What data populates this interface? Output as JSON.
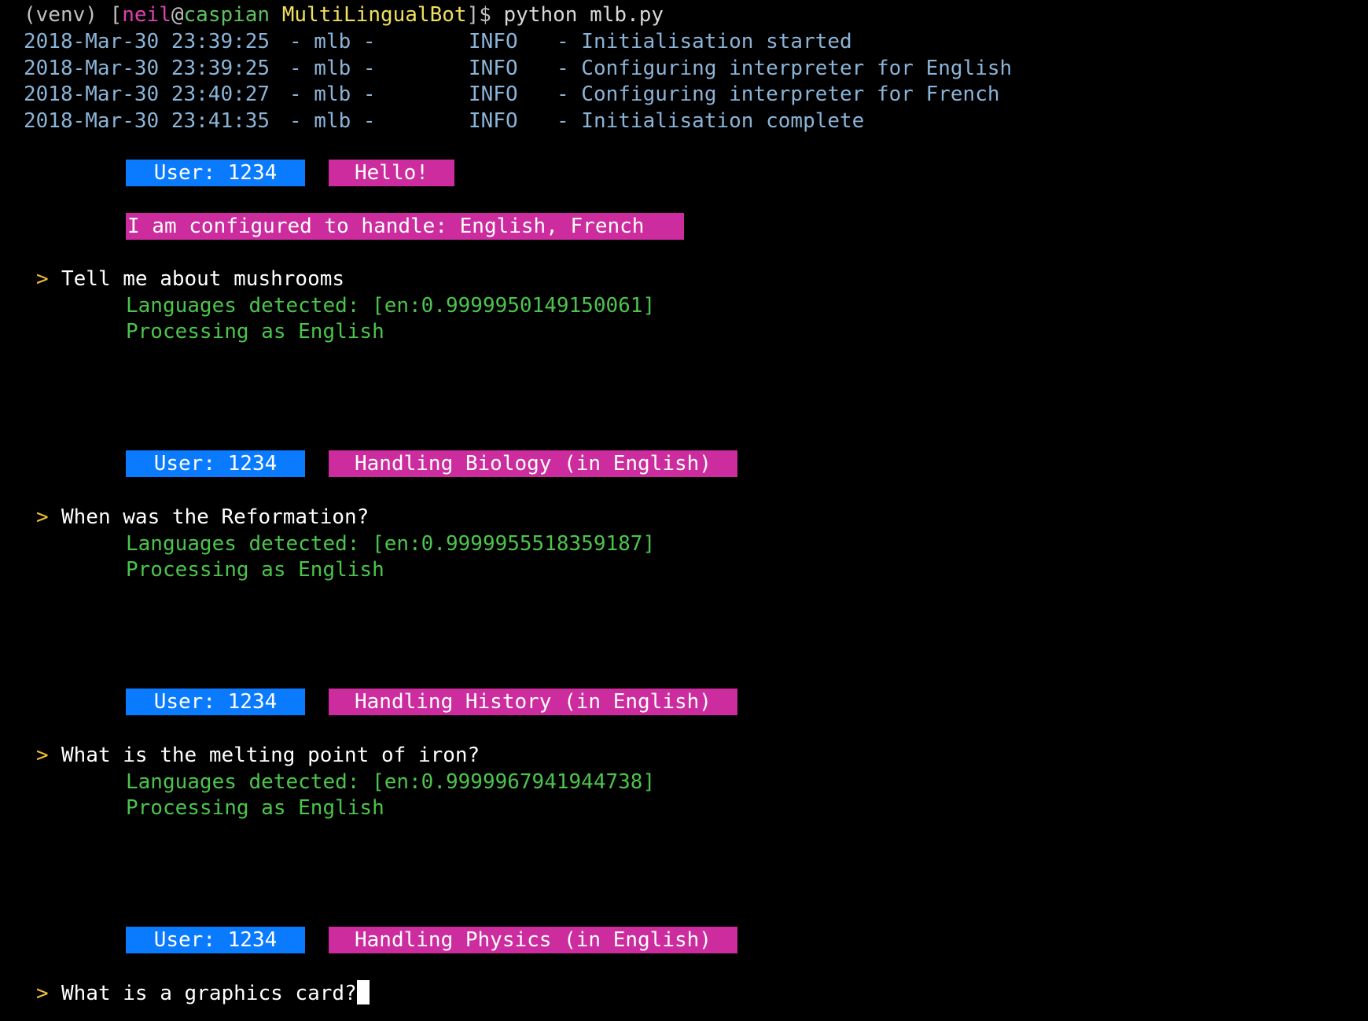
{
  "terminal": {
    "prompt": {
      "venv": "(venv)",
      "open_bracket": "[",
      "user": "neil",
      "at": "@",
      "host": "caspian",
      "dir": "MultiLingualBot",
      "close": "]$",
      "command": "python mlb.py"
    },
    "log": [
      {
        "timestamp": "2018-Mar-30 23:39:25",
        "source": "- mlb -",
        "level": "INFO",
        "message": "- Initialisation started"
      },
      {
        "timestamp": "2018-Mar-30 23:39:25",
        "source": "- mlb -",
        "level": "INFO",
        "message": "- Configuring interpreter for English"
      },
      {
        "timestamp": "2018-Mar-30 23:40:27",
        "source": "- mlb -",
        "level": "INFO",
        "message": "- Configuring interpreter for French"
      },
      {
        "timestamp": "2018-Mar-30 23:41:35",
        "source": "- mlb -",
        "level": "INFO",
        "message": "- Initialisation complete"
      }
    ],
    "greeting": {
      "user_badge": "User: 1234",
      "reply": "Hello!",
      "config": "I am configured to handle: English, French"
    },
    "exchanges": [
      {
        "caret": ">",
        "input": "Tell me about mushrooms",
        "detected": "Languages detected: [en:0.9999950149150061]",
        "processing": "Processing as English",
        "user_badge": "User: 1234",
        "reply": "Handling Biology (in English)"
      },
      {
        "caret": ">",
        "input": "When was the Reformation?",
        "detected": "Languages detected: [en:0.9999955518359187]",
        "processing": "Processing as English",
        "user_badge": "User: 1234",
        "reply": "Handling History (in English)"
      },
      {
        "caret": ">",
        "input": "What is the melting point of iron?",
        "detected": "Languages detected: [en:0.9999967941944738]",
        "processing": "Processing as English",
        "user_badge": "User: 1234",
        "reply": "Handling Physics (in English)"
      }
    ],
    "current_input": {
      "caret": ">",
      "text": "What is a graphics card?"
    },
    "colors": {
      "background": "#000000",
      "log_text": "#8ab4d8",
      "user_badge": "#0a7bff",
      "reply_badge": "#cc2c9e",
      "detection_text": "#4cc44c"
    }
  }
}
